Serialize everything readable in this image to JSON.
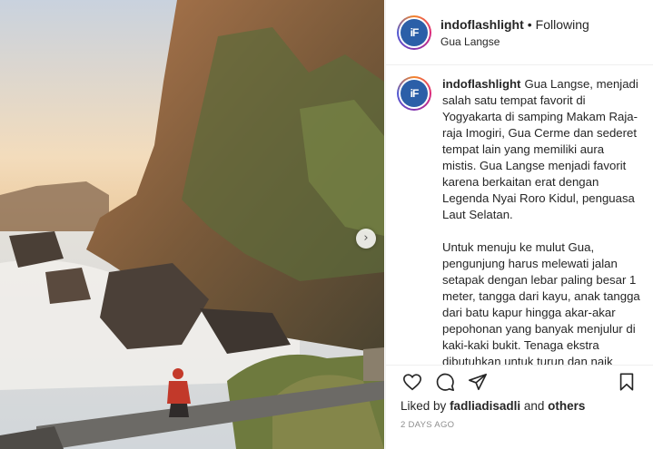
{
  "post": {
    "username": "indoflashlight",
    "separator": "•",
    "follow_status": "Following",
    "location": "Gua Langse",
    "avatar_text": "iF",
    "caption_username": "indoflashlight",
    "caption_p1": "Gua Langse, menjadi salah satu tempat favorit di Yogyakarta di samping Makam Raja-raja Imogiri, Gua Cerme dan sederet tempat lain yang memiliki aura mistis. Gua Langse menjadi favorit karena berkaitan erat dengan Legenda Nyai Roro Kidul, penguasa Laut Selatan.",
    "caption_p2": "Untuk menuju ke mulut Gua, pengunjung harus melewati jalan setapak dengan lebar paling besar 1 meter, tangga dari kayu, anak tangga dari batu kapur hingga akar-akar pepohonan yang banyak menjulur di kaki-kaki bukit. Tenaga ekstra dibutuhkan untuk turun dan naik tangga tersebut.",
    "likes_prefix": "Liked by",
    "liked_by": "fadliadisadli",
    "likes_and": "and",
    "likes_others": "others",
    "timestamp": "2 DAYS AGO"
  },
  "icons": {
    "like": "heart-icon",
    "comment": "comment-icon",
    "share": "share-icon",
    "save": "bookmark-icon",
    "next": "chevron-right-icon"
  },
  "colors": {
    "text": "#262626",
    "muted": "#8e8e8e",
    "border": "#efefef",
    "avatar_bg": "#2b5fa8"
  }
}
